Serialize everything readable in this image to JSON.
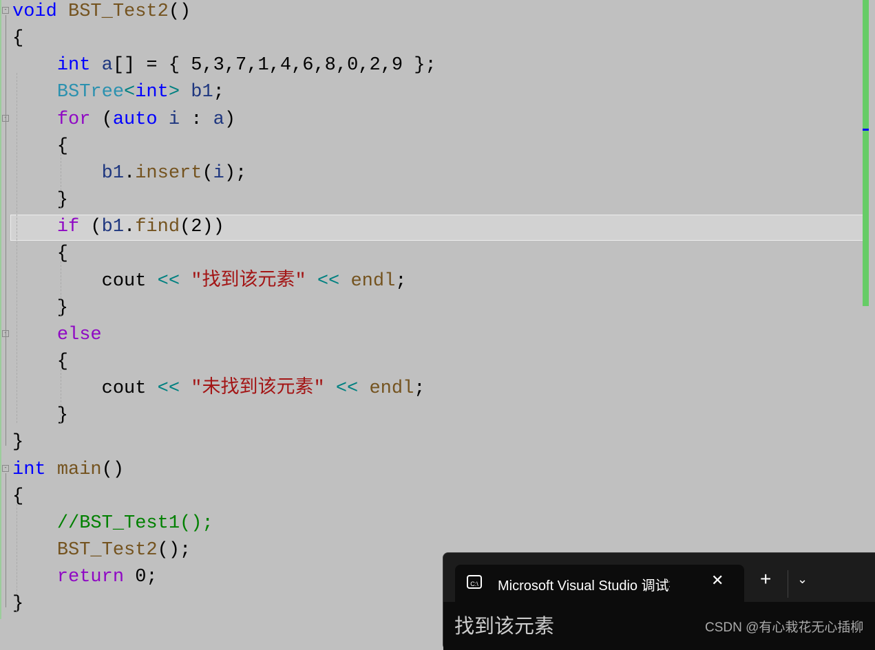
{
  "editor": {
    "highlighted_line": 9,
    "folds": [
      1,
      5,
      13,
      18
    ],
    "lines": [
      [
        [
          "kw",
          "void"
        ],
        [
          "pl",
          " "
        ],
        [
          "fn",
          "BST_Test2"
        ],
        [
          "pl",
          "()"
        ]
      ],
      [
        [
          "pl",
          "{"
        ]
      ],
      [
        [
          "pl",
          "    "
        ],
        [
          "kw",
          "int"
        ],
        [
          "pl",
          " "
        ],
        [
          "var",
          "a"
        ],
        [
          "pl",
          "[] = { 5,3,7,1,4,6,8,0,2,9 };"
        ]
      ],
      [
        [
          "pl",
          "    "
        ],
        [
          "ty",
          "BSTree"
        ],
        [
          "op",
          "<"
        ],
        [
          "kw",
          "int"
        ],
        [
          "op",
          ">"
        ],
        [
          "pl",
          " "
        ],
        [
          "var",
          "b1"
        ],
        [
          "pl",
          ";"
        ]
      ],
      [
        [
          "pl",
          "    "
        ],
        [
          "ctl",
          "for"
        ],
        [
          "pl",
          " ("
        ],
        [
          "kw",
          "auto"
        ],
        [
          "pl",
          " "
        ],
        [
          "var",
          "i"
        ],
        [
          "pl",
          " : "
        ],
        [
          "var",
          "a"
        ],
        [
          "pl",
          ")"
        ]
      ],
      [
        [
          "pl",
          "    {"
        ]
      ],
      [
        [
          "pl",
          "        "
        ],
        [
          "var",
          "b1"
        ],
        [
          "pl",
          "."
        ],
        [
          "fn",
          "insert"
        ],
        [
          "pl",
          "("
        ],
        [
          "var",
          "i"
        ],
        [
          "pl",
          ");"
        ]
      ],
      [
        [
          "pl",
          "    }"
        ]
      ],
      [
        [
          "pl",
          "    "
        ],
        [
          "ctl",
          "if"
        ],
        [
          "pl",
          " ("
        ],
        [
          "var",
          "b1"
        ],
        [
          "pl",
          "."
        ],
        [
          "fn",
          "find"
        ],
        [
          "pl",
          "(2))"
        ]
      ],
      [
        [
          "pl",
          "    {"
        ]
      ],
      [
        [
          "pl",
          "        cout "
        ],
        [
          "op",
          "<<"
        ],
        [
          "pl",
          " "
        ],
        [
          "str",
          "\"找到该元素\""
        ],
        [
          "pl",
          " "
        ],
        [
          "op",
          "<<"
        ],
        [
          "pl",
          " "
        ],
        [
          "fn",
          "endl"
        ],
        [
          "pl",
          ";"
        ]
      ],
      [
        [
          "pl",
          "    }"
        ]
      ],
      [
        [
          "pl",
          "    "
        ],
        [
          "ctl",
          "else"
        ]
      ],
      [
        [
          "pl",
          "    {"
        ]
      ],
      [
        [
          "pl",
          "        cout "
        ],
        [
          "op",
          "<<"
        ],
        [
          "pl",
          " "
        ],
        [
          "str",
          "\"未找到该元素\""
        ],
        [
          "pl",
          " "
        ],
        [
          "op",
          "<<"
        ],
        [
          "pl",
          " "
        ],
        [
          "fn",
          "endl"
        ],
        [
          "pl",
          ";"
        ]
      ],
      [
        [
          "pl",
          "    }"
        ]
      ],
      [
        [
          "pl",
          "}"
        ]
      ],
      [
        [
          "kw",
          "int"
        ],
        [
          "pl",
          " "
        ],
        [
          "fn",
          "main"
        ],
        [
          "pl",
          "()"
        ]
      ],
      [
        [
          "pl",
          "{"
        ]
      ],
      [
        [
          "pl",
          "    "
        ],
        [
          "cm",
          "//BST_Test1();"
        ]
      ],
      [
        [
          "pl",
          "    "
        ],
        [
          "fn",
          "BST_Test2"
        ],
        [
          "pl",
          "();"
        ]
      ],
      [
        [
          "pl",
          "    "
        ],
        [
          "ctl",
          "return"
        ],
        [
          "pl",
          " 0;"
        ]
      ],
      [
        [
          "pl",
          "}"
        ]
      ]
    ]
  },
  "terminal": {
    "tab_icon": "console-icon",
    "tab_title": "Microsoft Visual Studio 调试控制台",
    "close_icon": "✕",
    "new_tab_icon": "+",
    "dropdown_icon": "⌄",
    "output": "找到该元素"
  },
  "watermark": "CSDN @有心栽花无心插柳"
}
